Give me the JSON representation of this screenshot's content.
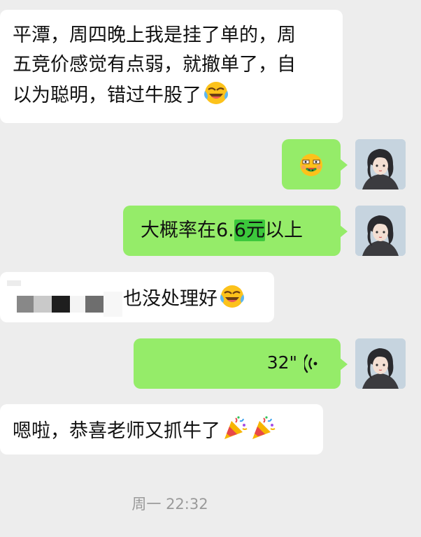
{
  "messages": [
    {
      "line1": "平潭，周四晚上我是挂了单的，周",
      "line2": "五竞价感觉有点弱，就撤单了，自",
      "line3": "以为聪明，错过牛股了"
    },
    {
      "emoji": "eating-emoji"
    },
    {
      "prefix": "大概率在",
      "price": "6.",
      "price_hl": "6元",
      "suffix": "以上"
    },
    {
      "text": "也没处理好"
    },
    {
      "voice_duration": "32\""
    },
    {
      "text": "嗯啦，恭喜老师又抓牛了"
    }
  ],
  "timestamp": "周一 22:32",
  "colors": {
    "background": "#ededed",
    "bubble_right": "#95ec69",
    "bubble_left": "#ffffff",
    "highlight": "#3cc83c"
  },
  "icons": [
    "crying-laughing-emoji",
    "eating-emoji",
    "party-popper-emoji",
    "voice-wave-icon"
  ]
}
